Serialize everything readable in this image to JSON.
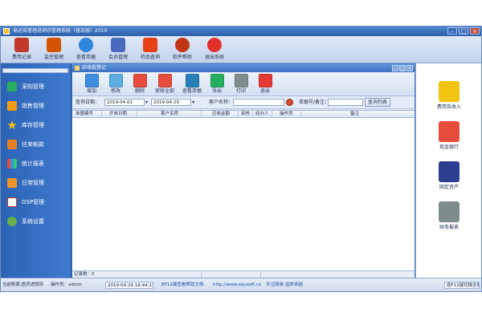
{
  "window": {
    "title": "易达库管理进销存管理系统（普及版）2019"
  },
  "toolbar": {
    "items": [
      {
        "label": "费用记录",
        "icon": "notebook-icon",
        "color": "#c0392b"
      },
      {
        "label": "监控管理",
        "icon": "grid-monitor-icon",
        "color": "#d35400"
      },
      {
        "label": "查看单据",
        "icon": "magnifier-icon",
        "color": "#2e86de"
      },
      {
        "label": "会员管理",
        "icon": "users-icon",
        "color": "#4a69bd"
      },
      {
        "label": "药品查询",
        "icon": "medicine-icon",
        "color": "#e84118"
      },
      {
        "label": "软件帮助",
        "icon": "help-icon",
        "color": "#c23616"
      },
      {
        "label": "退出系统",
        "icon": "power-icon",
        "color": "#e1302a"
      }
    ]
  },
  "leftnav": {
    "items": [
      {
        "label": "采购管理",
        "icon": "plus-icon",
        "color": "#27ae60"
      },
      {
        "label": "销售管理",
        "icon": "sales-icon",
        "color": "#f39c12"
      },
      {
        "label": "库存管理",
        "icon": "star-icon",
        "color": "#f1c40f"
      },
      {
        "label": "往来帐款",
        "icon": "money-icon",
        "color": "#e67e22"
      },
      {
        "label": "统计报表",
        "icon": "bar-chart-icon",
        "color": "#e74c3c"
      },
      {
        "label": "日常管理",
        "icon": "briefcase-icon",
        "color": "#f0932b"
      },
      {
        "label": "GSP管理",
        "icon": "gsp-icon",
        "color": "#f8f9fa"
      },
      {
        "label": "系统设置",
        "icon": "gear-icon",
        "color": "#6ab04c"
      }
    ]
  },
  "mdi": {
    "title": "应收款登记",
    "toolbar": [
      {
        "label": "增加",
        "icon": "add-doc-icon",
        "color": "#3c8dde"
      },
      {
        "label": "修改",
        "icon": "edit-doc-icon",
        "color": "#5dade2"
      },
      {
        "label": "删除",
        "icon": "delete-icon",
        "color": "#e74c3c"
      },
      {
        "label": "审核全部",
        "icon": "approve-all-icon",
        "color": "#e74c3c"
      },
      {
        "label": "查看单据",
        "icon": "view-doc-icon",
        "color": "#2980b9"
      },
      {
        "label": "导出",
        "icon": "export-icon",
        "color": "#27ae60"
      },
      {
        "label": "打印",
        "icon": "printer-icon",
        "color": "#7f8c8d"
      },
      {
        "label": "退出",
        "icon": "exit-icon",
        "color": "#e53935"
      }
    ],
    "filter": {
      "date_label": "查询日期：",
      "date_from": "2019-04-01",
      "date_to": "2019-04-29",
      "customer_label": "客户名称：",
      "customer_value": "",
      "docno_label": "单据号/备注：",
      "docno_value": "",
      "query_button": "查询列表"
    },
    "columns": [
      "单据编号",
      "开单日期",
      "客户名称",
      "应收金额",
      "审核",
      "经办人",
      "操作员",
      "备注"
    ],
    "footer": {
      "count_label": "记录数：0"
    }
  },
  "rightpanel": {
    "items": [
      {
        "label": "费用及收入",
        "icon": "coins-icon",
        "color": "#f1c40f"
      },
      {
        "label": "现金银行",
        "icon": "cash-bank-icon",
        "color": "#e74c3c"
      },
      {
        "label": "固定资产",
        "icon": "building-icon",
        "color": "#2c3e90"
      },
      {
        "label": "财务报表",
        "icon": "report-icon",
        "color": "#7f8c8d"
      }
    ]
  },
  "statusbar": {
    "company": "当前账套:医药进销存",
    "operator": "操作员：admin",
    "datetime": "2019-04-29 16:44:13",
    "help": "BF12键查看帮助文档",
    "url": "http://www.equsoft.com/",
    "slogan": "专注简单  追求卓越",
    "fullscreen": "按F12键切换全屏幕"
  }
}
